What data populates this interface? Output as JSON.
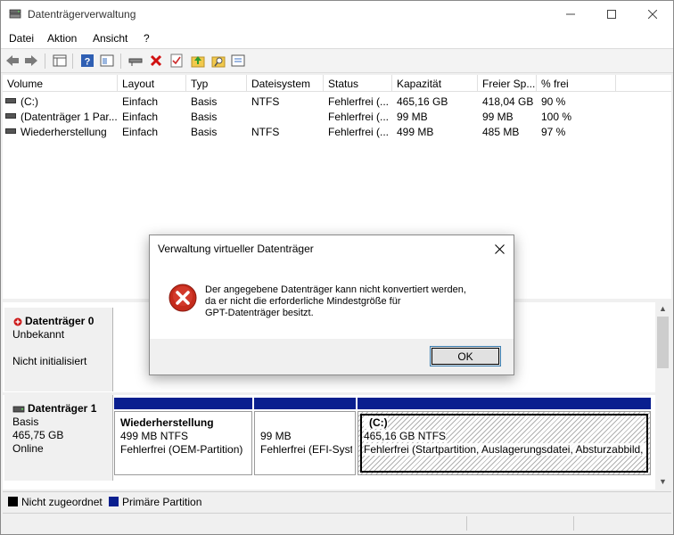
{
  "window": {
    "title": "Datenträgerverwaltung",
    "controls": {
      "minimize": "—",
      "maximize": "☐",
      "close": "✕"
    }
  },
  "menu": [
    "Datei",
    "Aktion",
    "Ansicht",
    "?"
  ],
  "toolbar": {
    "icons": [
      "back-arrow-icon",
      "forward-arrow-icon",
      "list-view-icon",
      "help-icon",
      "panel-icon",
      "connect-icon",
      "delete-icon",
      "check-icon",
      "up-folder-icon",
      "search-folder-icon",
      "properties-icon"
    ]
  },
  "volume_table": {
    "columns": [
      "Volume",
      "Layout",
      "Typ",
      "Dateisystem",
      "Status",
      "Kapazität",
      "Freier Sp...",
      "% frei"
    ],
    "rows": [
      {
        "volume": "(C:)",
        "layout": "Einfach",
        "typ": "Basis",
        "fs": "NTFS",
        "status": "Fehlerfrei (...",
        "cap": "465,16 GB",
        "free": "418,04 GB",
        "pct": "90 %"
      },
      {
        "volume": "(Datenträger 1 Par...",
        "layout": "Einfach",
        "typ": "Basis",
        "fs": "",
        "status": "Fehlerfrei (...",
        "cap": "99 MB",
        "free": "99 MB",
        "pct": "100 %"
      },
      {
        "volume": "Wiederherstellung",
        "layout": "Einfach",
        "typ": "Basis",
        "fs": "NTFS",
        "status": "Fehlerfrei (...",
        "cap": "499 MB",
        "free": "485 MB",
        "pct": "97 %"
      }
    ]
  },
  "disk0": {
    "name": "Datenträger 0",
    "type": "Unbekannt",
    "state": "Nicht initialisiert"
  },
  "disk1": {
    "name": "Datenträger 1",
    "type": "Basis",
    "size": "465,75 GB",
    "state": "Online",
    "partitions": [
      {
        "name": "Wiederherstellung",
        "size": "499 MB NTFS",
        "status": "Fehlerfrei (OEM-Partition)"
      },
      {
        "name": "",
        "size": "99 MB",
        "status": "Fehlerfrei (EFI-Syste"
      },
      {
        "name": "(C:)",
        "size": "465,16 GB NTFS",
        "status": "Fehlerfrei (Startpartition, Auslagerungsdatei, Absturzabbild, I"
      }
    ]
  },
  "legend": {
    "unallocated": {
      "label": "Nicht zugeordnet",
      "color": "#000000"
    },
    "primary": {
      "label": "Primäre Partition",
      "color": "#0a1f8f"
    }
  },
  "dialog": {
    "title": "Verwaltung virtueller Datenträger",
    "message_line1": "Der angegebene Datenträger kann nicht konvertiert werden,",
    "message_line2": "da er nicht die erforderliche Mindestgröße für",
    "message_line3": "GPT-Datenträger besitzt.",
    "ok_label": "OK",
    "close_glyph": "✕",
    "icon": "error-icon"
  }
}
